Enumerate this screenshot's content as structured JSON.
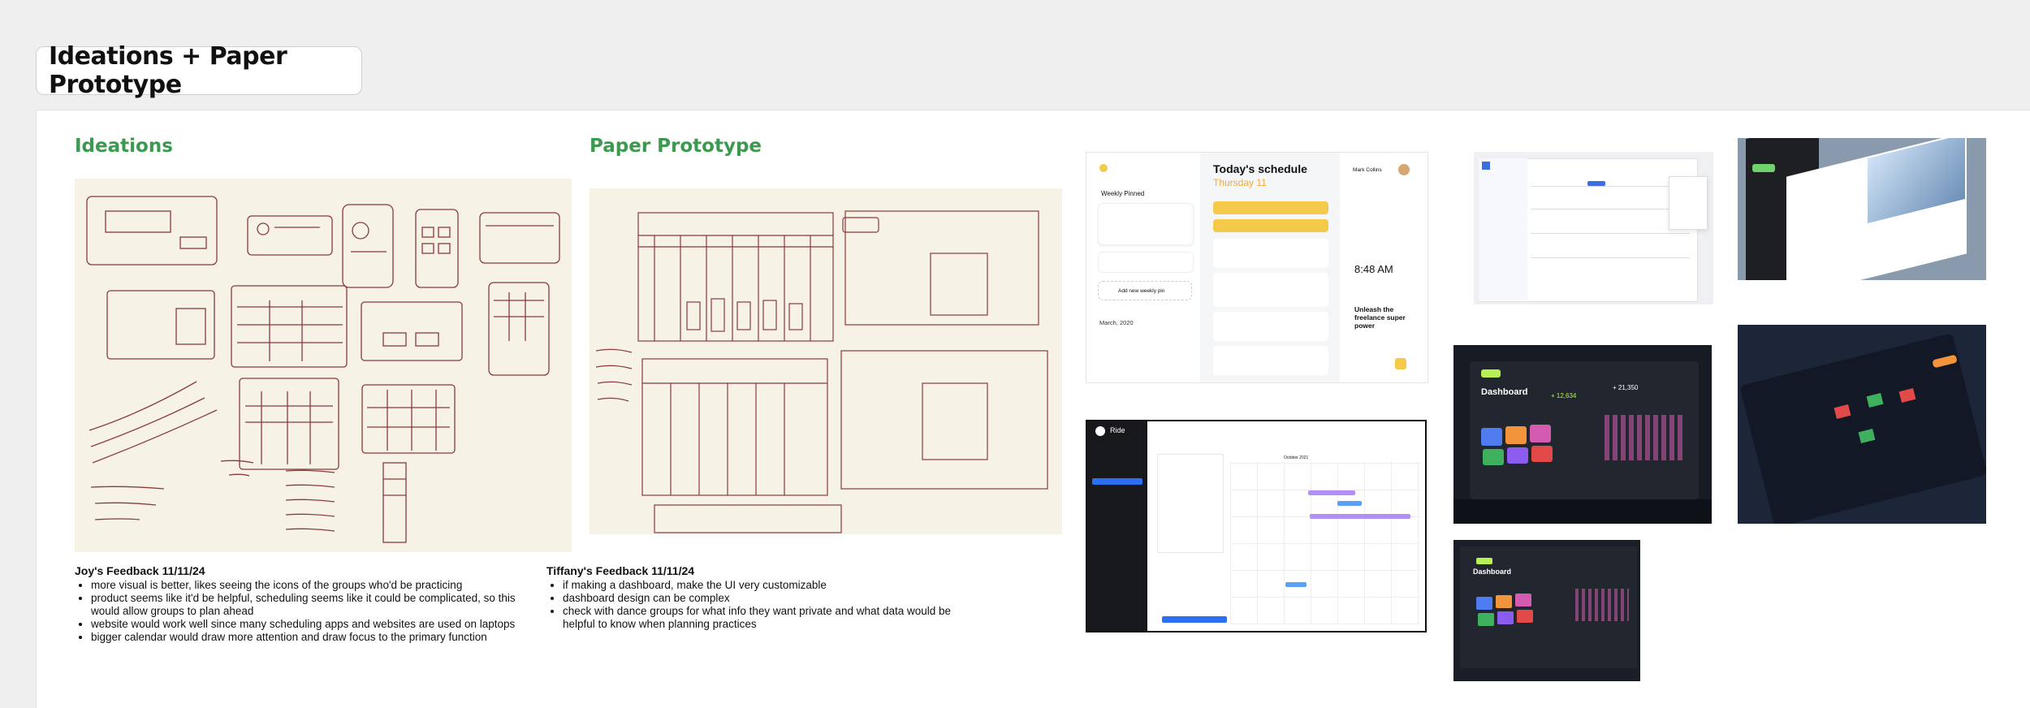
{
  "board": {
    "title": "Ideations + Paper Prototype"
  },
  "ideations": {
    "heading": "Ideations"
  },
  "paper_prototype": {
    "heading": "Paper Prototype"
  },
  "joy_feedback": {
    "heading": "Joy's Feedback 11/11/24",
    "items": [
      "more visual is better, likes seeing the icons of the groups who'd be practicing",
      "product seems like it'd be helpful, scheduling seems like it could be complicated, so this would allow groups to plan ahead",
      "website would work well since many scheduling apps and websites are used on laptops",
      "bigger calendar would draw more attention and draw focus to the primary function"
    ]
  },
  "tiffany_feedback": {
    "heading": "Tiffany's Feedback 11/11/24",
    "items": [
      "if making a dashboard, make the UI very customizable",
      "dashboard design can be complex",
      "check with dance groups for what info they want private and what data would be helpful to know when planning practices"
    ]
  },
  "inspo_schedule": {
    "title": "Today's schedule",
    "date": "Thursday 11",
    "time": "8:48 AM",
    "promo": "Unleash the freelance super power",
    "month": "March, 2020",
    "weekly": "Weekly Pinned",
    "add": "Add new weekly pin",
    "user": "Mark Collins"
  },
  "inspo_dashboard": {
    "title": "Dashboard",
    "amount1": "+ 12,634",
    "amount2": "+ 21,350"
  },
  "inspo_dashboard2": {
    "title": "Dashboard"
  },
  "inspo_calendar": {
    "brand": "Ride",
    "month": "October 2021"
  },
  "colors": {
    "accent_green": "#3b9a4f",
    "sketch_ink": "#8a3a3a",
    "paper": "#f7f2e6"
  }
}
